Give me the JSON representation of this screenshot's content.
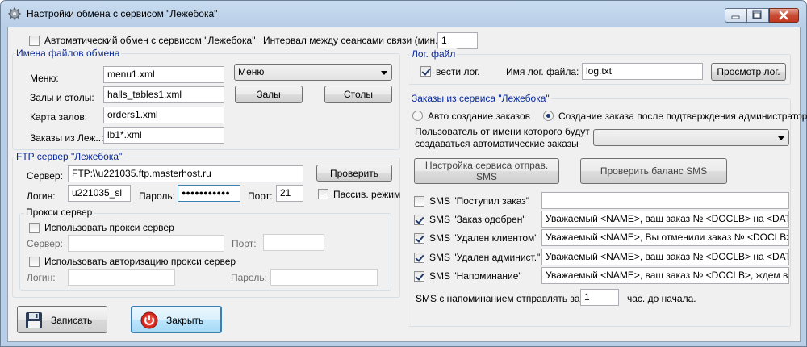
{
  "window": {
    "title": "Настройки обмена с сервисом \"Лежебока\"",
    "icon": "gear-icon"
  },
  "top": {
    "auto_exchange_label": "Автоматический обмен с сервисом \"Лежебока\"",
    "auto_exchange_checked": false,
    "interval_label": "Интервал между сеансами связи (мин.):",
    "interval_value": "1"
  },
  "files": {
    "group_title": "Имена файлов обмена",
    "menu_label": "Меню:",
    "menu_value": "menu1.xml",
    "halls_label": "Залы и столы:",
    "halls_value": "halls_tables1.xml",
    "map_label": "Карта залов:",
    "map_value": "orders1.xml",
    "orders_label": "Заказы из Леж..:",
    "orders_value": "lb1*.xml",
    "menu_combo_value": "Меню",
    "halls_button": "Залы",
    "tables_button": "Столы"
  },
  "ftp": {
    "group_title": "FTP сервер \"Лежебока\"",
    "server_label": "Сервер:",
    "server_value": "FTP:\\\\u221035.ftp.masterhost.ru",
    "check_button": "Проверить",
    "login_label": "Логин:",
    "login_value": "u221035_sl",
    "password_label": "Пароль:",
    "password_value": "●●●●●●●●●●●",
    "port_label": "Порт:",
    "port_value": "21",
    "passive_label": "Пассив. режим",
    "passive_checked": false
  },
  "proxy": {
    "group_title": "Прокси сервер",
    "use_proxy_label": "Использовать прокси сервер",
    "use_proxy_checked": false,
    "server_label": "Сервер:",
    "server_value": "",
    "port_label": "Порт:",
    "port_value": "",
    "use_auth_label": "Использовать авторизацию прокси сервер",
    "use_auth_checked": false,
    "login_label": "Логин:",
    "login_value": "",
    "password_label": "Пароль:",
    "password_value": ""
  },
  "log": {
    "group_title": "Лог. файл",
    "keep_log_label": "вести лог.",
    "keep_log_checked": true,
    "file_name_label": "Имя лог. файла:",
    "file_name_value": "log.txt",
    "view_button": "Просмотр лог."
  },
  "orders": {
    "group_title": "Заказы из сервиса \"Лежебока\"",
    "auto_radio": "Авто создание заказов",
    "confirm_radio": "Создание заказа после подтверждения администратором",
    "selected": "confirm",
    "user_label_1": "Пользователь от  имени которого будут",
    "user_label_2": "создаваться автоматические заказы",
    "user_value": "",
    "sms_setup_button": "Настройка сервиса отправ. SMS",
    "sms_balance_button": "Проверить баланс SMS",
    "sms": [
      {
        "label": "SMS \"Поступил заказ\"",
        "checked": false,
        "text": ""
      },
      {
        "label": "SMS \"Заказ одобрен\"",
        "checked": true,
        "text": "Уважаемый <NAME>, ваш заказ № <DOCLB> на <DATETIME>"
      },
      {
        "label": "SMS \"Удален клиентом\"",
        "checked": true,
        "text": "Уважаемый <NAME>, Вы отменили заказ № <DOCLB> на <"
      },
      {
        "label": "SMS \"Удален админист.\"",
        "checked": true,
        "text": "Уважаемый <NAME>, ваш заказ № <DOCLB> на <DATETIME>"
      },
      {
        "label": "SMS \"Напоминание\"",
        "checked": true,
        "text": "Уважаемый <NAME>, ваш заказ № <DOCLB>, ждем вас се"
      }
    ],
    "reminder_label": "SMS с напоминанием отправлять за",
    "reminder_value": "1",
    "reminder_suffix": "час. до начала."
  },
  "footer": {
    "save_button": "Записать",
    "close_button": "Закрыть",
    "save_icon": "floppy-disk-icon",
    "close_icon": "exit-power-icon"
  }
}
